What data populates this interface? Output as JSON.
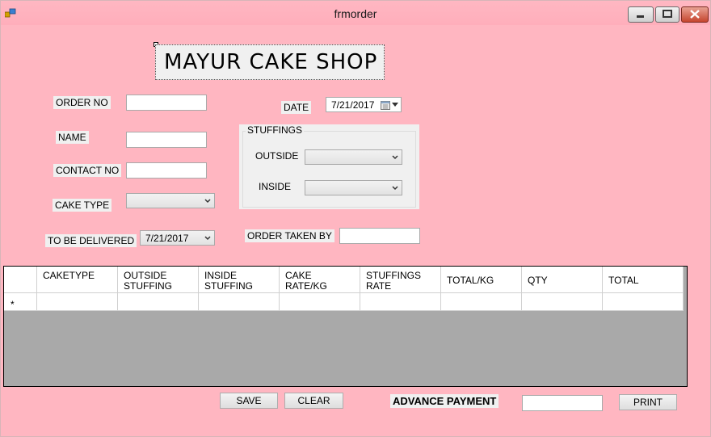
{
  "window": {
    "title": "frmorder"
  },
  "banner": {
    "title": "MAYUR CAKE SHOP"
  },
  "form": {
    "order_no_label": "ORDER NO",
    "order_no_value": "",
    "name_label": "NAME",
    "name_value": "",
    "contact_label": "CONTACT NO",
    "contact_value": "",
    "cake_type_label": "CAKE TYPE",
    "cake_type_value": "",
    "deliver_label": "TO BE DELIVERED",
    "deliver_date": "7/21/2017",
    "date_label": "DATE",
    "date_value": "7/21/2017",
    "order_taken_label": "ORDER TAKEN BY",
    "order_taken_value": ""
  },
  "stuffings": {
    "legend": "STUFFINGS",
    "outside_label": "OUTSIDE",
    "outside_value": "",
    "inside_label": "INSIDE",
    "inside_value": ""
  },
  "grid": {
    "columns": [
      "CAKETYPE",
      "OUTSIDE\nSTUFFING",
      "INSIDE\nSTUFFING",
      "CAKE\nRATE/KG",
      "STUFFINGS\nRATE",
      "TOTAL/KG",
      "QTY",
      "TOTAL"
    ],
    "new_row_marker": "*"
  },
  "actions": {
    "save_label": "SAVE",
    "clear_label": "CLEAR",
    "advance_label": "ADVANCE PAYMENT",
    "advance_value": "",
    "print_label": "PRINT"
  },
  "colors": {
    "form_bg": "#ffb6c1",
    "panel_bg": "#f0f0f0",
    "grid_bg": "#a9a9a9"
  }
}
